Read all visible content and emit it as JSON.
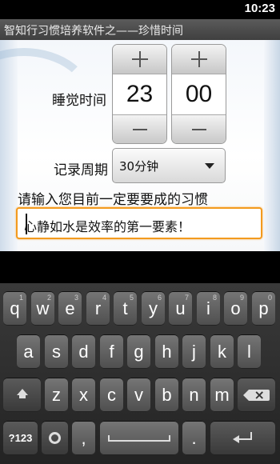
{
  "status_bar": {
    "time": "10:23"
  },
  "window": {
    "title": "智知行习惯培养软件之——珍惜时间"
  },
  "form": {
    "sleep_time_label": "睡觉时间",
    "hour_value": "23",
    "minute_value": "00",
    "record_period_label": "记录周期",
    "record_period_selected": "30分钟",
    "habit_prompt": "请输入您目前一定要要成的习惯",
    "habit_input_value": "心静如水是效率的第一要素！"
  },
  "keyboard": {
    "row1": [
      {
        "label": "q",
        "sub": "1"
      },
      {
        "label": "w",
        "sub": "2"
      },
      {
        "label": "e",
        "sub": "3"
      },
      {
        "label": "r",
        "sub": "4"
      },
      {
        "label": "t",
        "sub": "5"
      },
      {
        "label": "y",
        "sub": "6"
      },
      {
        "label": "u",
        "sub": "7"
      },
      {
        "label": "i",
        "sub": "8"
      },
      {
        "label": "o",
        "sub": "9"
      },
      {
        "label": "p",
        "sub": "0"
      }
    ],
    "row2": [
      "a",
      "s",
      "d",
      "f",
      "g",
      "h",
      "j",
      "k",
      "l"
    ],
    "row3": [
      "z",
      "x",
      "c",
      "v",
      "b",
      "n",
      "m"
    ],
    "symbols_label": "?123",
    "comma_label": ",",
    "period_label": ".",
    "icons": [
      "shift-icon",
      "backspace-icon",
      "settings-icon",
      "space-icon",
      "enter-icon"
    ]
  },
  "colors": {
    "input_focus_border": "#f39a1e",
    "title_bar": "#4a4a4a"
  }
}
